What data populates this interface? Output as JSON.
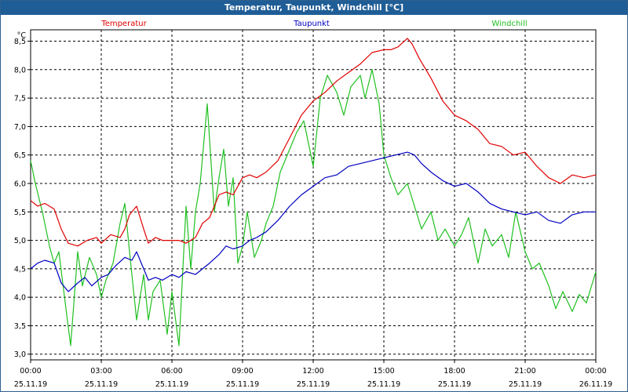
{
  "window": {
    "title": "Temperatur, Taupunkt, Windchill [°C]"
  },
  "colors": {
    "titlebar": "#1f5d96",
    "temperatur": "#e00000",
    "taupunkt": "#0000c0",
    "windchill": "#20c020"
  },
  "chart_data": {
    "type": "line",
    "ylabel": "°C",
    "ylim": [
      2.9,
      8.7
    ],
    "yticks": [
      "3,0",
      "3,5",
      "4,0",
      "4,5",
      "5,0",
      "5,5",
      "6,0",
      "6,5",
      "7,0",
      "7,5",
      "8,0",
      "8,5"
    ],
    "xlim": [
      0,
      24
    ],
    "xticks": [
      {
        "time": "00:00",
        "date": "25.11.19"
      },
      {
        "time": "03:00",
        "date": "25.11.19"
      },
      {
        "time": "06:00",
        "date": "25.11.19"
      },
      {
        "time": "09:00",
        "date": "25.11.19"
      },
      {
        "time": "12:00",
        "date": "25.11.19"
      },
      {
        "time": "15:00",
        "date": "25.11.19"
      },
      {
        "time": "18:00",
        "date": "25.11.19"
      },
      {
        "time": "21:00",
        "date": "25.11.19"
      },
      {
        "time": "00:00",
        "date": "26.11.19"
      }
    ],
    "grid": true,
    "legend_position": "top",
    "series": [
      {
        "name": "Temperatur",
        "x": [
          0,
          0.3,
          0.6,
          1,
          1.3,
          1.6,
          2,
          2.4,
          2.8,
          3,
          3.4,
          3.8,
          4,
          4.2,
          4.5,
          4.8,
          5,
          5.3,
          5.6,
          6,
          6.3,
          6.6,
          7,
          7.3,
          7.6,
          8,
          8.3,
          8.6,
          9,
          9.3,
          9.6,
          10,
          10.5,
          11,
          11.5,
          12,
          12.5,
          13,
          13.5,
          14,
          14.5,
          15,
          15.3,
          15.6,
          16,
          16.2,
          16.5,
          17,
          17.5,
          18,
          18.5,
          19,
          19.5,
          20,
          20.5,
          21,
          21.5,
          22,
          22.5,
          23,
          23.5,
          24
        ],
        "values": [
          5.7,
          5.6,
          5.65,
          5.55,
          5.2,
          4.95,
          4.9,
          5.0,
          5.05,
          4.95,
          5.1,
          5.05,
          5.2,
          5.45,
          5.6,
          5.2,
          4.95,
          5.05,
          5.0,
          5.0,
          5.0,
          4.95,
          5.05,
          5.3,
          5.4,
          5.8,
          5.85,
          5.8,
          6.1,
          6.15,
          6.1,
          6.2,
          6.4,
          6.8,
          7.2,
          7.45,
          7.6,
          7.8,
          7.95,
          8.1,
          8.3,
          8.35,
          8.35,
          8.4,
          8.55,
          8.45,
          8.2,
          7.85,
          7.45,
          7.2,
          7.1,
          6.95,
          6.7,
          6.65,
          6.5,
          6.55,
          6.3,
          6.1,
          6.0,
          6.15,
          6.1,
          6.15
        ]
      },
      {
        "name": "Taupunkt",
        "x": [
          0,
          0.3,
          0.6,
          1,
          1.3,
          1.6,
          2,
          2.3,
          2.6,
          3,
          3.3,
          3.6,
          4,
          4.3,
          4.5,
          4.8,
          5,
          5.3,
          5.6,
          6,
          6.3,
          6.6,
          7,
          7.3,
          7.6,
          8,
          8.3,
          8.6,
          9,
          9.3,
          9.6,
          10,
          10.5,
          11,
          11.5,
          12,
          12.5,
          13,
          13.5,
          14,
          14.5,
          15,
          15.5,
          16,
          16.3,
          16.6,
          17,
          17.5,
          18,
          18.5,
          19,
          19.5,
          20,
          20.5,
          21,
          21.5,
          22,
          22.5,
          23,
          23.5,
          24
        ],
        "values": [
          4.5,
          4.6,
          4.65,
          4.6,
          4.25,
          4.1,
          4.25,
          4.35,
          4.2,
          4.35,
          4.4,
          4.55,
          4.7,
          4.65,
          4.8,
          4.5,
          4.3,
          4.35,
          4.3,
          4.4,
          4.35,
          4.45,
          4.4,
          4.5,
          4.6,
          4.75,
          4.9,
          4.85,
          4.9,
          5.0,
          5.05,
          5.15,
          5.35,
          5.6,
          5.8,
          5.95,
          6.1,
          6.15,
          6.3,
          6.35,
          6.4,
          6.45,
          6.5,
          6.55,
          6.5,
          6.35,
          6.2,
          6.05,
          5.95,
          6.0,
          5.85,
          5.65,
          5.55,
          5.5,
          5.45,
          5.5,
          5.35,
          5.3,
          5.45,
          5.5,
          5.5
        ]
      },
      {
        "name": "Windchill",
        "x": [
          0,
          0.2,
          0.5,
          0.8,
          1,
          1.2,
          1.5,
          1.7,
          2,
          2.2,
          2.5,
          2.8,
          3,
          3.2,
          3.5,
          3.8,
          4,
          4.2,
          4.5,
          4.8,
          5,
          5.2,
          5.5,
          5.8,
          6,
          6.3,
          6.6,
          6.8,
          7,
          7.2,
          7.5,
          7.8,
          8,
          8.2,
          8.4,
          8.6,
          8.8,
          9,
          9.2,
          9.5,
          9.8,
          10,
          10.3,
          10.6,
          11,
          11.3,
          11.6,
          12,
          12.3,
          12.6,
          13,
          13.3,
          13.6,
          14,
          14.2,
          14.5,
          14.8,
          15,
          15.3,
          15.6,
          16,
          16.3,
          16.6,
          17,
          17.3,
          17.6,
          18,
          18.3,
          18.6,
          19,
          19.3,
          19.6,
          20,
          20.3,
          20.6,
          21,
          21.3,
          21.6,
          22,
          22.3,
          22.6,
          23,
          23.3,
          23.6,
          24
        ],
        "values": [
          6.4,
          6.0,
          5.5,
          4.9,
          4.6,
          4.8,
          3.8,
          3.15,
          4.8,
          4.2,
          4.7,
          4.4,
          4.0,
          4.3,
          4.6,
          5.3,
          5.65,
          4.8,
          3.6,
          4.4,
          3.6,
          4.1,
          4.3,
          3.35,
          4.1,
          3.15,
          5.6,
          4.5,
          5.5,
          6.0,
          7.4,
          5.5,
          6.1,
          6.6,
          5.6,
          6.1,
          4.6,
          4.9,
          5.5,
          4.7,
          5.0,
          5.3,
          5.6,
          6.2,
          6.6,
          6.9,
          7.1,
          6.3,
          7.5,
          7.9,
          7.6,
          7.2,
          7.7,
          7.9,
          7.5,
          8.0,
          7.4,
          6.5,
          6.1,
          5.8,
          6.0,
          5.6,
          5.2,
          5.5,
          5.0,
          5.2,
          4.9,
          5.1,
          5.4,
          4.6,
          5.2,
          4.9,
          5.1,
          4.7,
          5.5,
          4.8,
          4.5,
          4.6,
          4.2,
          3.8,
          4.1,
          3.75,
          4.05,
          3.9,
          4.45
        ]
      }
    ]
  }
}
